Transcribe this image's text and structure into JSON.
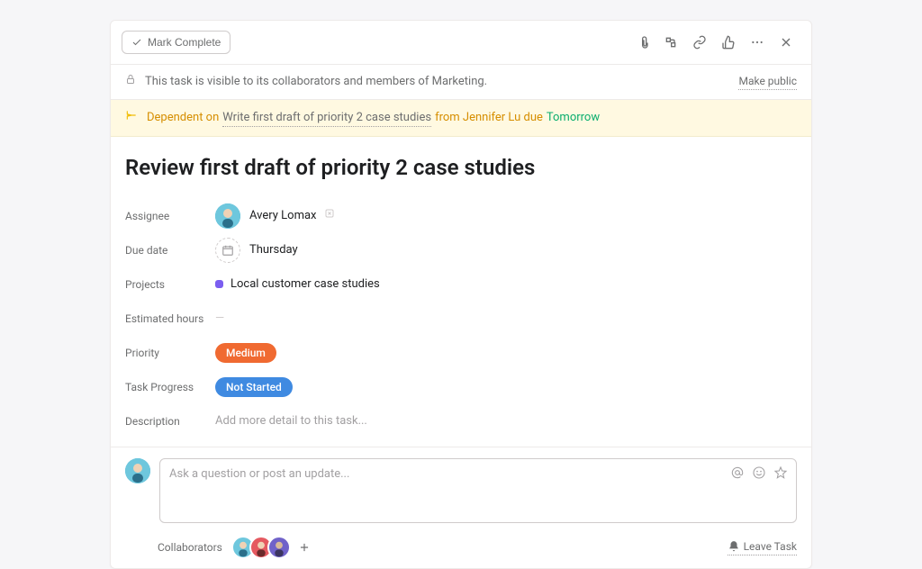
{
  "topbar": {
    "mark_complete_label": "Mark Complete"
  },
  "visibility": {
    "text": "This task is visible to its collaborators and members of Marketing.",
    "make_public_label": "Make public"
  },
  "dependency": {
    "prefix": "Dependent on",
    "task_title": "Write first draft of priority 2 case studies",
    "from_label": "from Jennifer Lu due",
    "due_text": "Tomorrow"
  },
  "task": {
    "title": "Review first draft of priority 2 case studies"
  },
  "fields": {
    "assignee": {
      "label": "Assignee",
      "name": "Avery Lomax"
    },
    "due_date": {
      "label": "Due date",
      "value": "Thursday"
    },
    "projects": {
      "label": "Projects",
      "value": "Local customer case studies",
      "dot_color": "#7b5ef0"
    },
    "estimated_hours": {
      "label": "Estimated hours",
      "value": "—"
    },
    "priority": {
      "label": "Priority",
      "value": "Medium",
      "color": "orange"
    },
    "progress": {
      "label": "Task Progress",
      "value": "Not Started",
      "color": "blue"
    },
    "description": {
      "label": "Description",
      "placeholder": "Add more detail to this task..."
    }
  },
  "comment": {
    "placeholder": "Ask a question or post an update..."
  },
  "footer": {
    "collaborators_label": "Collaborators",
    "leave_label": "Leave Task"
  }
}
